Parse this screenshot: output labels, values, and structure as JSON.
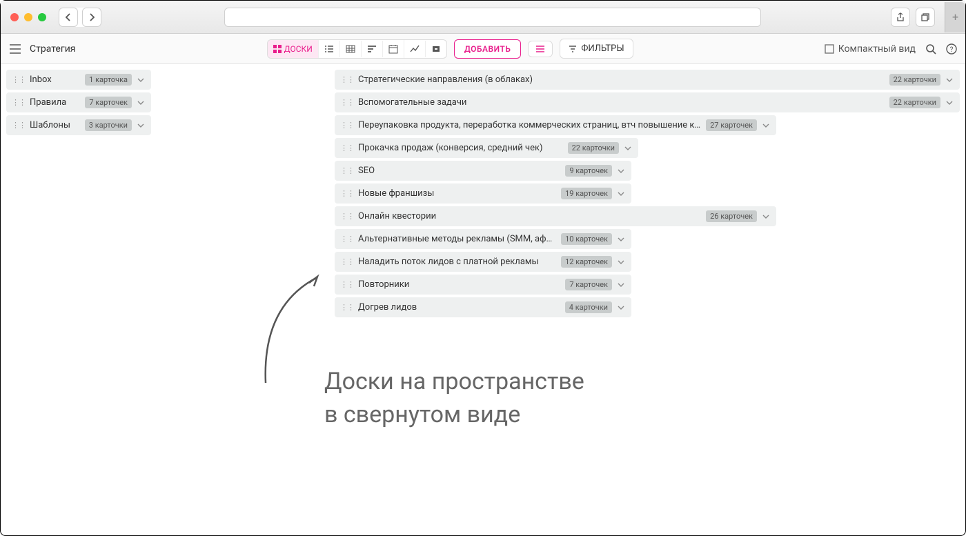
{
  "page_title": "Стратегия",
  "toolbar": {
    "boards_label": "ДОСКИ",
    "add_label": "ДОБАВИТЬ",
    "filters_label": "ФИЛЬТРЫ",
    "compact_label": "Компактный вид"
  },
  "left_boards": [
    {
      "title": "Inbox",
      "badge": "1 карточка"
    },
    {
      "title": "Правила",
      "badge": "7 карточек"
    },
    {
      "title": "Шаблоны",
      "badge": "3 карточки"
    }
  ],
  "right_boards": [
    {
      "title": "Стратегические направления (в облаках)",
      "badge": "22 карточки",
      "width": "full"
    },
    {
      "title": "Вспомогательные задачи",
      "badge": "22 карточки",
      "width": "full"
    },
    {
      "title": "Переупаковка продукта, переработка коммерческих страниц, втч повышение конверсии",
      "badge": "27 карточек",
      "width": "640"
    },
    {
      "title": "Прокачка продаж (конверсия, средний чек)",
      "badge": "22 карточки",
      "width": "440"
    },
    {
      "title": "SEO",
      "badge": "9 карточек",
      "width": "430"
    },
    {
      "title": "Новые франшизы",
      "badge": "19 карточек",
      "width": "430"
    },
    {
      "title": "Онлайн квестории",
      "badge": "26 карточек",
      "width": "640"
    },
    {
      "title": "Альтернативные методы рекламы (SMM, афиши)",
      "badge": "10 карточек",
      "width": "430"
    },
    {
      "title": "Наладить поток лидов с платной рекламы",
      "badge": "12 карточек",
      "width": "430"
    },
    {
      "title": "Повторники",
      "badge": "7 карточек",
      "width": "430"
    },
    {
      "title": "Догрев лидов",
      "badge": "4 карточки",
      "width": "430"
    }
  ],
  "annotation": {
    "line1": "Доски на пространстве",
    "line2": "в свернутом виде"
  }
}
